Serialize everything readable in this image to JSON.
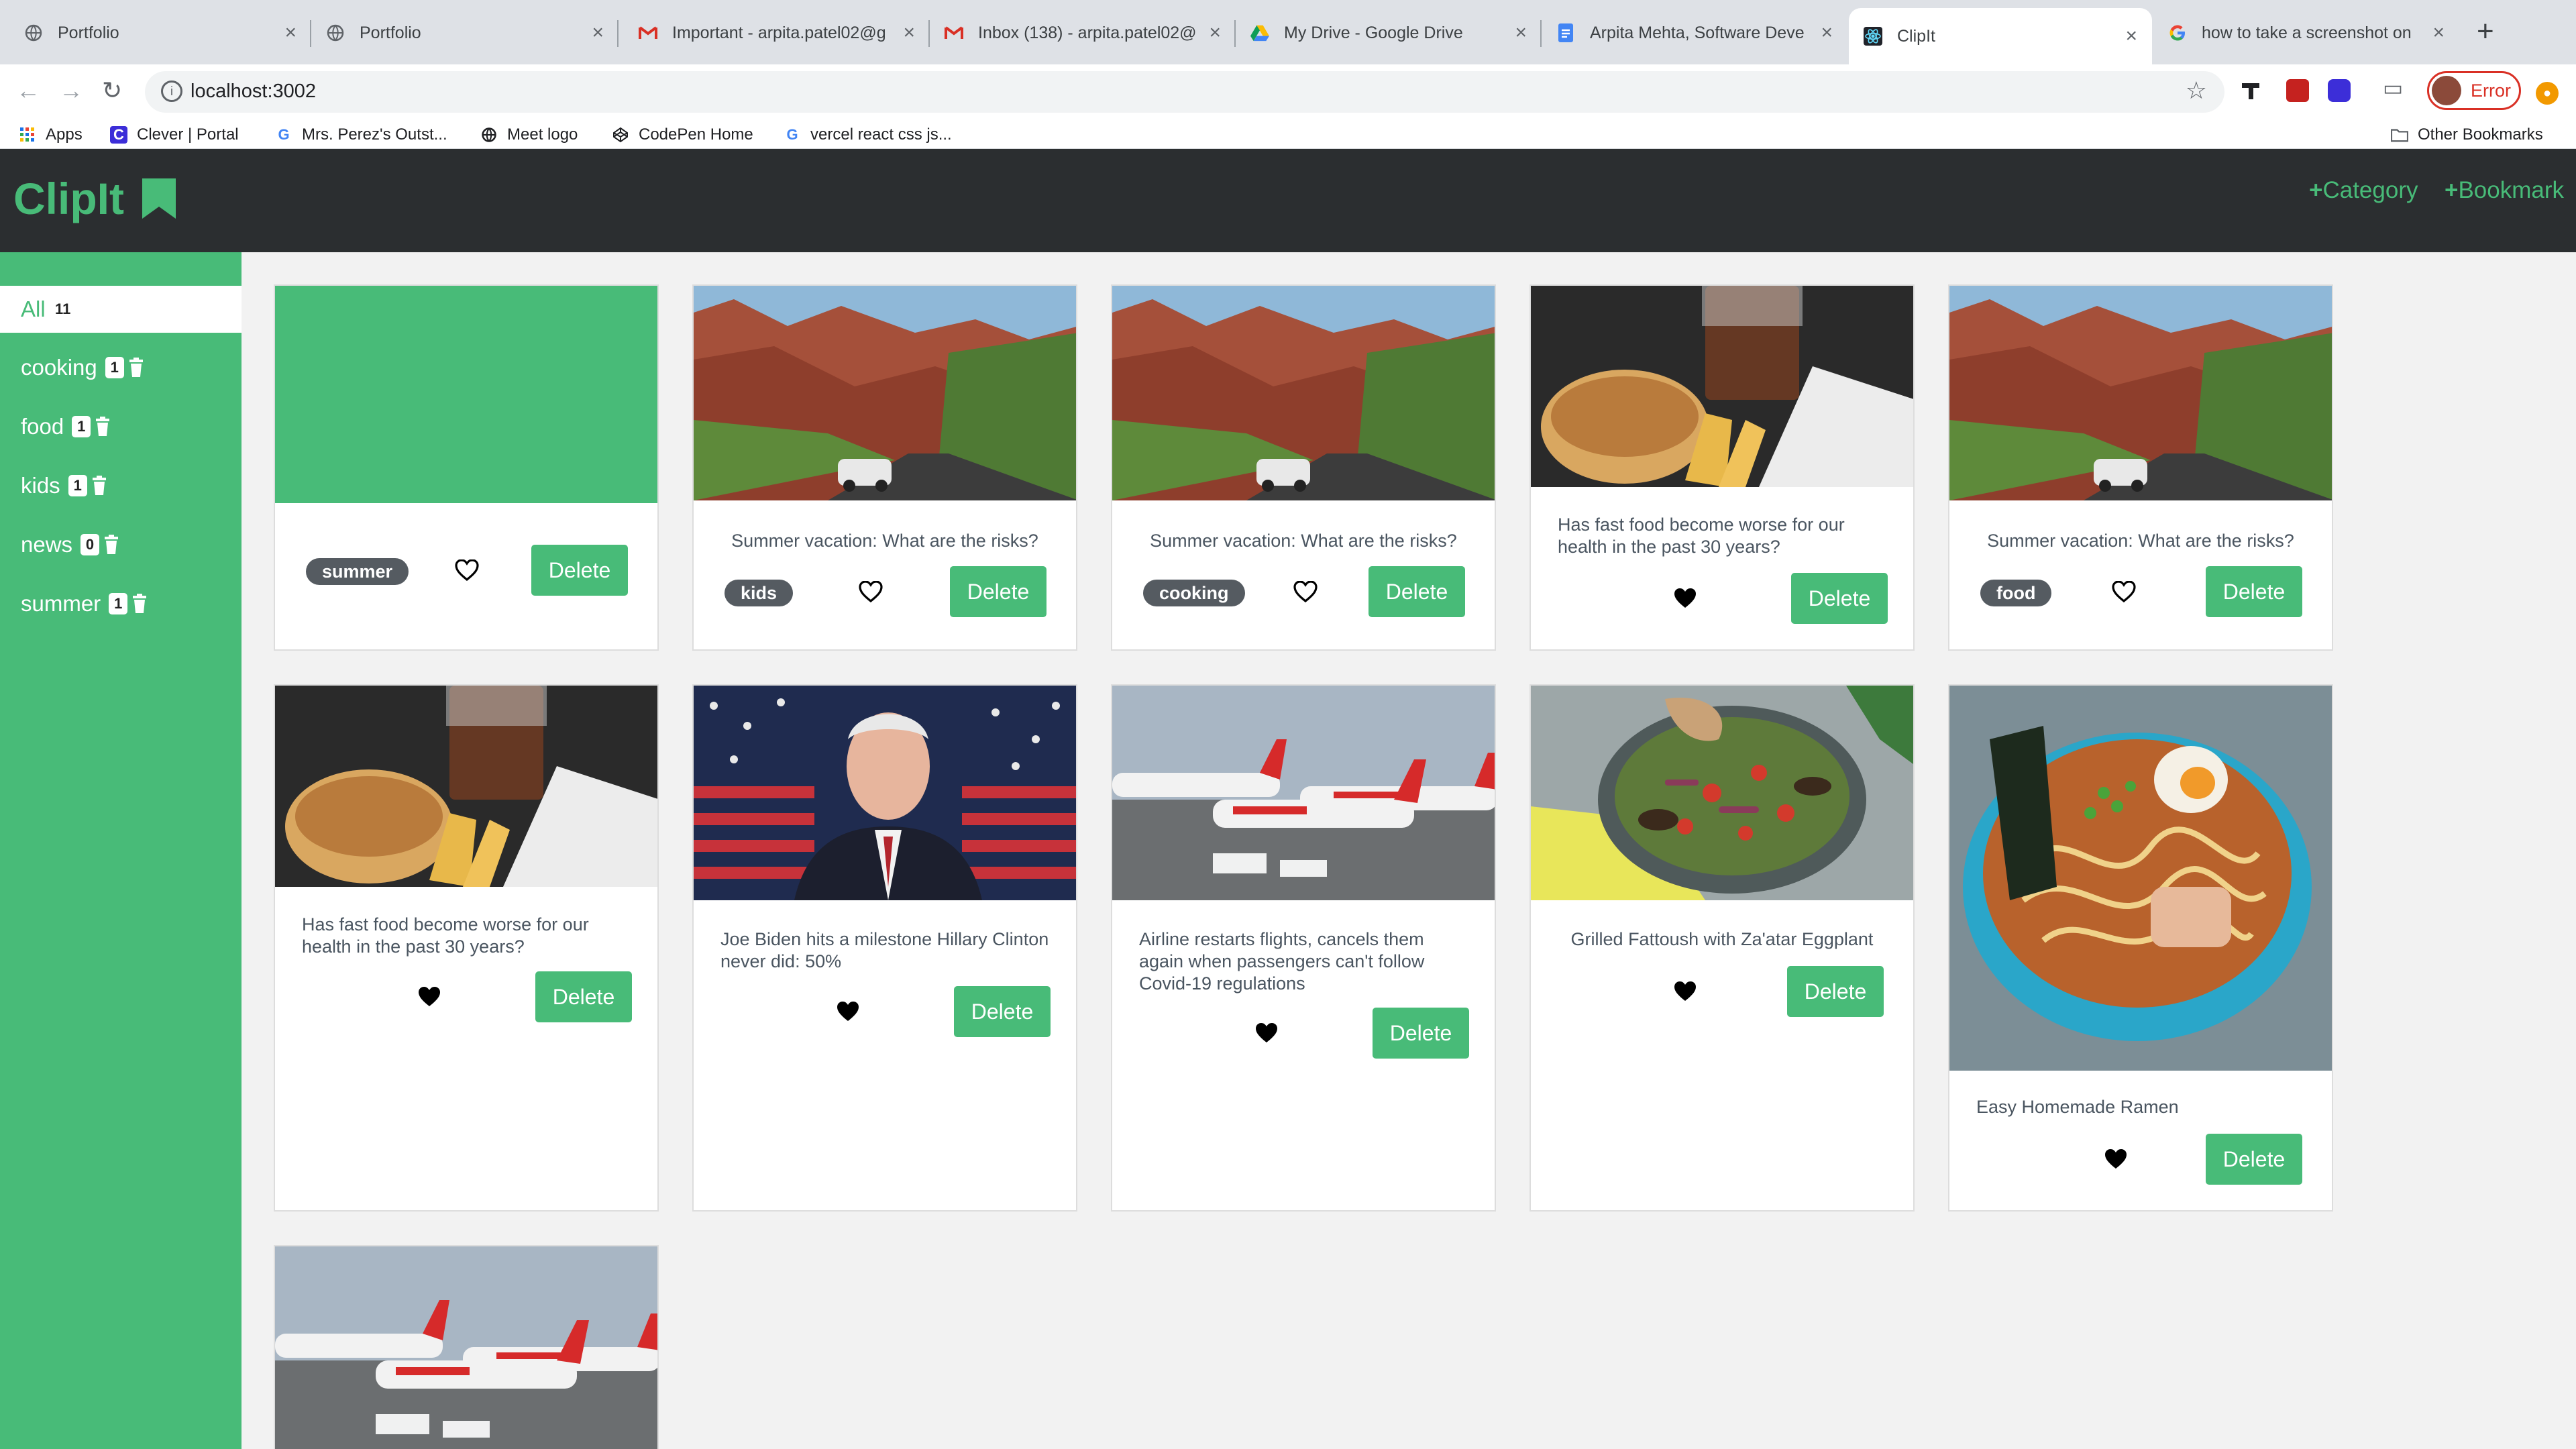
{
  "browser": {
    "tabs": [
      {
        "title": "Portfolio",
        "icon": "globe-icon"
      },
      {
        "title": "Portfolio",
        "icon": "globe-icon"
      },
      {
        "title": "Important - arpita.patel02@g",
        "icon": "gmail-icon"
      },
      {
        "title": "Inbox (138) - arpita.patel02@",
        "icon": "gmail-icon"
      },
      {
        "title": "My Drive - Google Drive",
        "icon": "drive-icon"
      },
      {
        "title": "Arpita Mehta, Software Deve",
        "icon": "docs-icon"
      },
      {
        "title": "ClipIt",
        "icon": "react-icon",
        "active": true
      },
      {
        "title": "how to take a screenshot on",
        "icon": "google-icon"
      }
    ],
    "new_tab": "+",
    "close_glyph": "×",
    "url": "localhost:3002",
    "profile_status": "Error",
    "bookmarks": [
      {
        "label": "Apps",
        "icon": "apps-grid-icon"
      },
      {
        "label": "Clever | Portal",
        "icon": "clever-icon"
      },
      {
        "label": "Mrs. Perez's Outst...",
        "icon": "google-icon"
      },
      {
        "label": "Meet logo",
        "icon": "globe-icon"
      },
      {
        "label": "CodePen Home",
        "icon": "codepen-icon"
      },
      {
        "label": "vercel react css js...",
        "icon": "google-icon"
      }
    ],
    "other_bookmarks": "Other Bookmarks"
  },
  "app": {
    "logo": "ClipIt",
    "actions": {
      "category": "Category",
      "bookmark": "Bookmark"
    },
    "colors": {
      "accent": "#48bb78",
      "header": "#2b2e30",
      "tag": "#555b61"
    }
  },
  "sidebar": {
    "all": {
      "label": "All",
      "count": "11"
    },
    "categories": [
      {
        "label": "cooking",
        "count": "1"
      },
      {
        "label": "food",
        "count": "1"
      },
      {
        "label": "kids",
        "count": "1"
      },
      {
        "label": "news",
        "count": "0"
      },
      {
        "label": "summer",
        "count": "1"
      }
    ]
  },
  "cards": [
    {
      "image": "blank-green",
      "title": "",
      "tag": "summer",
      "favorite": false,
      "delete_label": "Delete"
    },
    {
      "image": "canyon-road",
      "title": "Summer vacation: What are the risks?",
      "tag": "kids",
      "favorite": false,
      "delete_label": "Delete"
    },
    {
      "image": "canyon-road",
      "title": "Summer vacation: What are the risks?",
      "tag": "cooking",
      "favorite": false,
      "delete_label": "Delete"
    },
    {
      "image": "fast-food",
      "title": "Has fast food become worse for our health in the past 30 years?",
      "tag": "",
      "favorite": true,
      "delete_label": "Delete"
    },
    {
      "image": "canyon-road",
      "title": "Summer vacation: What are the risks?",
      "tag": "food",
      "favorite": false,
      "delete_label": "Delete"
    },
    {
      "image": "fast-food",
      "title": "Has fast food become worse for our health in the past 30 years?",
      "tag": "",
      "favorite": true,
      "delete_label": "Delete"
    },
    {
      "image": "biden-flags",
      "title": "Joe Biden hits a milestone Hillary Clinton never did: 50%",
      "tag": "",
      "favorite": true,
      "delete_label": "Delete"
    },
    {
      "image": "airline-planes",
      "title": "Airline restarts flights, cancels them again when passengers can't follow Covid-19 regulations",
      "tag": "",
      "favorite": true,
      "delete_label": "Delete"
    },
    {
      "image": "fattoush-salad",
      "title": "Grilled Fattoush with Za'atar Eggplant",
      "tag": "",
      "favorite": true,
      "delete_label": "Delete"
    },
    {
      "image": "ramen-bowl",
      "title": "Easy Homemade Ramen",
      "tag": "",
      "favorite": true,
      "delete_label": "Delete"
    },
    {
      "image": "airline-planes",
      "title": "",
      "tag": "",
      "favorite": false,
      "delete_label": ""
    }
  ]
}
